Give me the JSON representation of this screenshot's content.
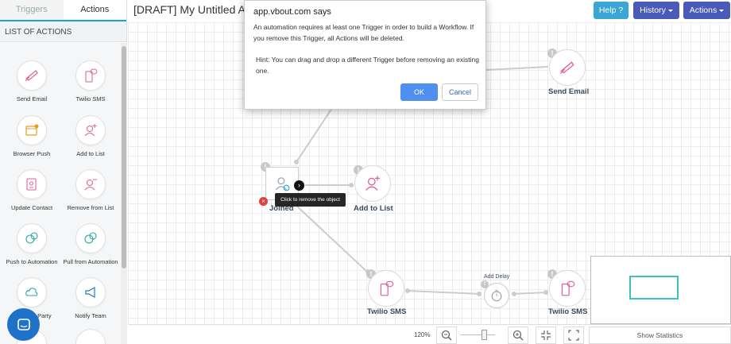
{
  "sidebar": {
    "tabs": [
      {
        "label": "Triggers"
      },
      {
        "label": "Actions"
      }
    ],
    "list_title": "LIST OF ACTIONS",
    "actions": [
      {
        "label": "Send Email",
        "icon": "send-email-icon"
      },
      {
        "label": "Twilio SMS",
        "icon": "sms-icon"
      },
      {
        "label": "Browser Push",
        "icon": "browser-push-icon"
      },
      {
        "label": "Add to List",
        "icon": "add-user-icon"
      },
      {
        "label": "Update Contact",
        "icon": "update-contact-icon"
      },
      {
        "label": "Remove from List",
        "icon": "remove-user-icon"
      },
      {
        "label": "Push to Automation",
        "icon": "push-automation-icon"
      },
      {
        "label": "Pull from Automation",
        "icon": "pull-automation-icon"
      },
      {
        "label": "Sync 3rd Party",
        "icon": "cloud-sync-icon"
      },
      {
        "label": "Notify Team",
        "icon": "megaphone-icon"
      }
    ]
  },
  "header": {
    "title": "[DRAFT] My Untitled Auto",
    "help_label": "Help ?",
    "history_label": "History",
    "actions_label": "Actions"
  },
  "canvas": {
    "nodes": {
      "send_email": "Send Email",
      "joined": "Joined",
      "add_to_list": "Add to List",
      "twilio_sms_1": "Twilio SMS",
      "twilio_sms_2": "Twilio SMS",
      "add_delay": "Add Delay"
    },
    "tooltip": "Click to remove the object"
  },
  "bottom": {
    "zoom": "120%",
    "show_statistics": "Show Statistics"
  },
  "dialog": {
    "title": "app.vbout.com says",
    "message": "An automation requires at least one Trigger in order to build a Workflow. If you remove this Trigger, all Actions will be deleted.",
    "hint": "Hint: You can drag and drop a different Trigger before removing an existing one.",
    "ok": "OK",
    "cancel": "Cancel"
  },
  "colors": {
    "accent": "#1aa2d8",
    "primary_button": "#4a5ab8",
    "help_button": "#3aa6d6",
    "ok_button": "#4f8ff0",
    "icon_pink": "#e0609a",
    "minimap_view": "#3cc0c0"
  }
}
